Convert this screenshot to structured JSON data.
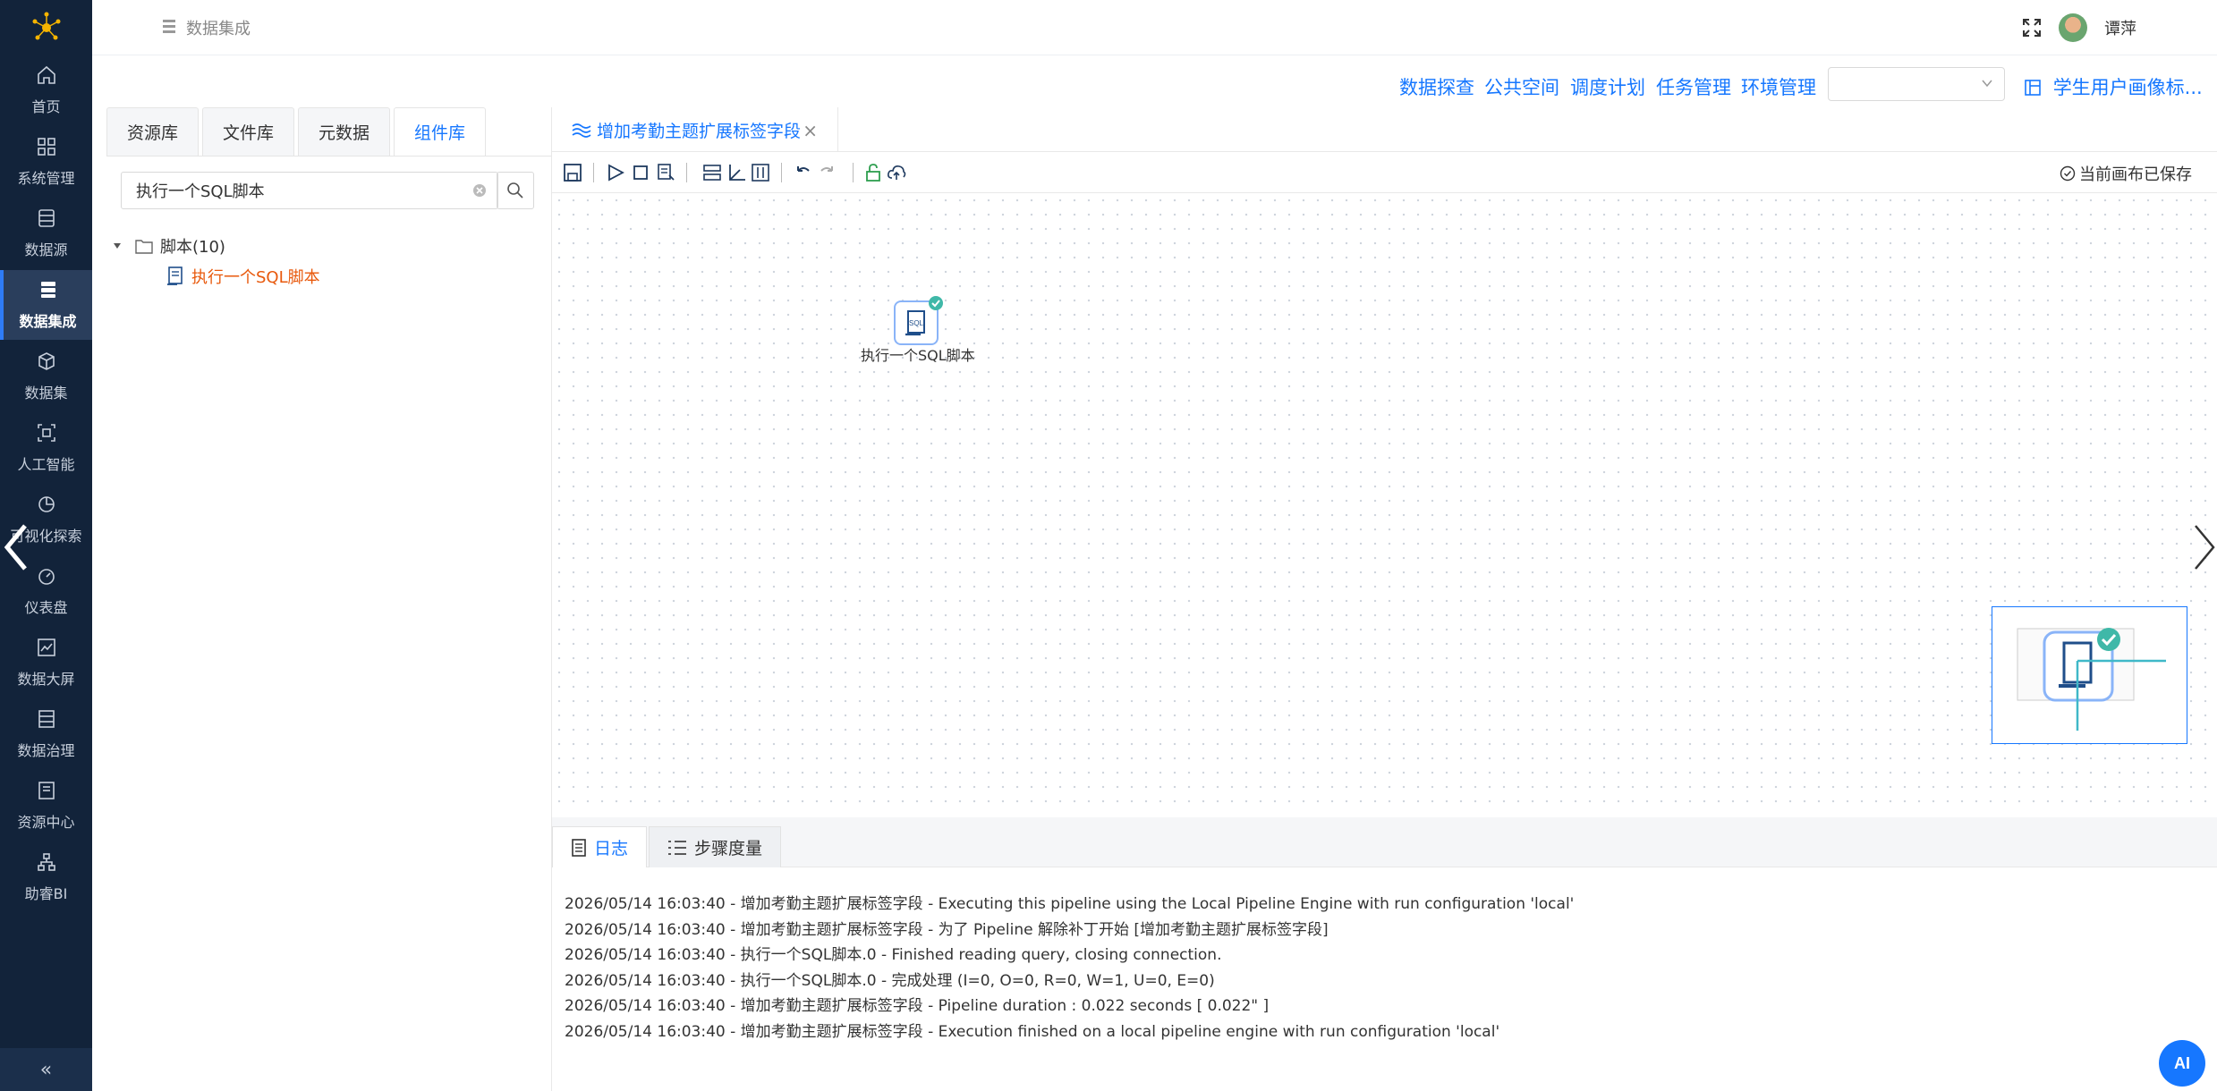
{
  "sidebar": {
    "items": [
      {
        "label": "首页",
        "icon": "home-icon"
      },
      {
        "label": "系统管理",
        "icon": "grid-icon"
      },
      {
        "label": "数据源",
        "icon": "database-icon"
      },
      {
        "label": "数据集成",
        "icon": "data-integration-icon",
        "active": true
      },
      {
        "label": "数据集",
        "icon": "cube-icon"
      },
      {
        "label": "人工智能",
        "icon": "ai-scan-icon"
      },
      {
        "label": "可视化探索",
        "icon": "pie-chart-icon"
      },
      {
        "label": "仪表盘",
        "icon": "gauge-icon"
      },
      {
        "label": "数据大屏",
        "icon": "line-chart-icon"
      },
      {
        "label": "数据治理",
        "icon": "list-icon"
      },
      {
        "label": "资源中心",
        "icon": "resource-icon"
      },
      {
        "label": "助睿BI",
        "icon": "org-chart-icon"
      }
    ],
    "collapse_label": "«"
  },
  "header": {
    "breadcrumb": "数据集成",
    "username": "谭萍"
  },
  "subnav": {
    "links": [
      "数据探查",
      "公共空间",
      "调度计划",
      "任务管理",
      "环境管理"
    ],
    "env_select_value": "",
    "pipeline_link": "学生用户画像标..."
  },
  "left_panel": {
    "tabs": [
      {
        "label": "资源库",
        "active": false
      },
      {
        "label": "文件库",
        "active": false
      },
      {
        "label": "元数据",
        "active": false
      },
      {
        "label": "组件库",
        "active": true
      }
    ],
    "search_value": "执行一个SQL脚本",
    "tree": {
      "folder_label": "脚本(10)",
      "leaf_label": "执行一个SQL脚本"
    }
  },
  "editor": {
    "tab_label": "增加考勤主题扩展标签字段",
    "close_label": "×",
    "saved_status": "当前画布已保存",
    "node": {
      "label": "执行一个SQL脚本",
      "badge": "SQL"
    }
  },
  "log_panel": {
    "tabs": [
      {
        "label": "日志",
        "active": true
      },
      {
        "label": "步骤度量",
        "active": false
      }
    ],
    "lines": [
      "2026/05/14 16:03:40 - 增加考勤主题扩展标签字段 - Executing this pipeline using the Local Pipeline Engine with run configuration 'local'",
      "2026/05/14 16:03:40 - 增加考勤主题扩展标签字段 - 为了 Pipeline 解除补丁开始 [增加考勤主题扩展标签字段]",
      "2026/05/14 16:03:40 - 执行一个SQL脚本.0 - Finished reading query, closing connection.",
      "2026/05/14 16:03:40 - 执行一个SQL脚本.0 - 完成处理 (I=0, O=0, R=0, W=1, U=0, E=0)",
      "2026/05/14 16:03:40 - 增加考勤主题扩展标签字段 - Pipeline duration : 0.022 seconds [  0.022\" ]",
      "2026/05/14 16:03:40 - 增加考勤主题扩展标签字段 - Execution finished on a local pipeline engine with run configuration 'local'"
    ]
  },
  "ai_button": "AI",
  "colors": {
    "sidebar_bg": "#12233a",
    "accent": "#1677ff",
    "tree_leaf": "#e8590c"
  }
}
